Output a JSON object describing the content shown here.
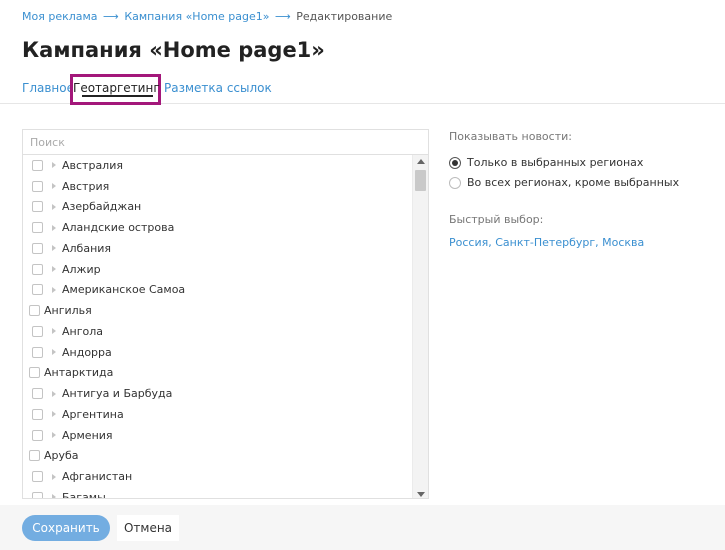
{
  "breadcrumb": {
    "items": [
      "Моя реклама",
      "Кампания «Home page1»"
    ],
    "current": "Редактирование",
    "separator": "⟶"
  },
  "page_title": "Кампания «Home page1»",
  "tabs": {
    "main": "Главное",
    "geo": "Геотаргетинг",
    "links": "Разметка ссылок",
    "active": "geo"
  },
  "region_list": {
    "search_placeholder": "Поиск",
    "rows": [
      {
        "label": "Австралия",
        "expandable": true
      },
      {
        "label": "Австрия",
        "expandable": true
      },
      {
        "label": "Азербайджан",
        "expandable": true
      },
      {
        "label": "Аландские острова",
        "expandable": true
      },
      {
        "label": "Албания",
        "expandable": true
      },
      {
        "label": "Алжир",
        "expandable": true
      },
      {
        "label": "Американское Самоа",
        "expandable": true
      },
      {
        "label": "Ангилья",
        "expandable": false
      },
      {
        "label": "Ангола",
        "expandable": true
      },
      {
        "label": "Андорра",
        "expandable": true
      },
      {
        "label": "Антарктида",
        "expandable": false
      },
      {
        "label": "Антигуа и Барбуда",
        "expandable": true
      },
      {
        "label": "Аргентина",
        "expandable": true
      },
      {
        "label": "Армения",
        "expandable": true
      },
      {
        "label": "Аруба",
        "expandable": false
      },
      {
        "label": "Афганистан",
        "expandable": true
      },
      {
        "label": "Багамы",
        "expandable": true
      }
    ]
  },
  "news_display": {
    "label": "Показывать новости:",
    "options": [
      "Только в выбранных регионах",
      "Во всех регионах, кроме выбранных"
    ],
    "selected_index": 0
  },
  "quick_select": {
    "label": "Быстрый выбор:",
    "links": [
      "Россия",
      "Санкт-Петербург",
      "Москва"
    ],
    "separator": ", "
  },
  "footer": {
    "save_label": "Сохранить",
    "cancel_label": "Отмена"
  },
  "colors": {
    "link": "#3a8fd0",
    "highlight_border": "#a3177a",
    "save_button": "#73ade1"
  }
}
